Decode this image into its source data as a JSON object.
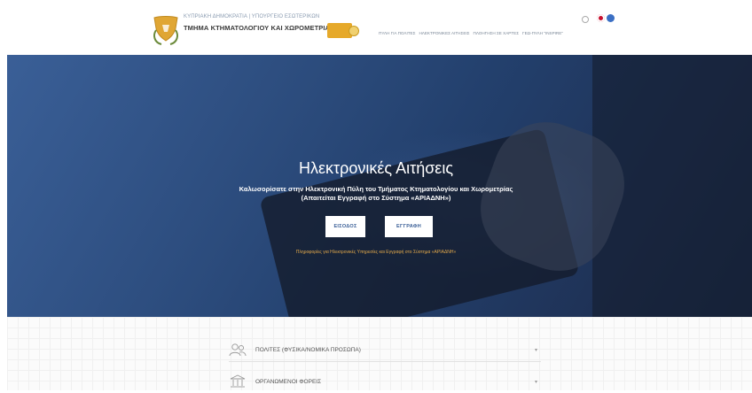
{
  "header": {
    "logo_subtitle": "ΚΥΠΡΙΑΚΗ ΔΗΜΟΚΡΑΤΙΑ | ΥΠΟΥΡΓΕΙΟ ΕΣΩΤΕΡΙΚΩΝ",
    "logo_title": "ΤΜΗΜΑ ΚΤΗΜΑΤΟΛΟΓΙΟΥ ΚΑΙ ΧΩΡΟΜΕΤΡΙΑΣ",
    "nav": [
      "ΠΥΛΗ ΓΙΑ ΠΟΛΙΤΕΣ",
      "ΗΛΕΚΤΡΟΝΙΚΕΣ ΑΙΤΗΣΕΙΣ",
      "ΠΛΟΗΓΗΣΗ ΣΕ ΧΑΡΤΕΣ",
      "ΓΕΩ-ΠΥΛΗ \"INSPIRE\""
    ]
  },
  "hero": {
    "title": "Ηλεκτρονικές Αιτήσεις",
    "subtitle_line1": "Καλωσορίσατε στην Ηλεκτρονική Πύλη του Τμήματος Κτηματολογίου και Χωρομετρίας",
    "subtitle_line2": "(Απαιτείται Εγγραφή στο Σύστημα «ΑΡΙΑΔΝΗ»)",
    "login_label": "ΕΙΣΟΔΟΣ",
    "register_label": "ΕΓΓΡΑΦΗ",
    "info_link": "Πληροφορίες για Ηλεκτρονικές Υπηρεσίες και Εγγραφή στο Σύστημα «ΑΡΙΑΔΝΗ»"
  },
  "categories": [
    {
      "label": "ΠΟΛΙΤΕΣ (ΦΥΣΙΚΑ/ΝΟΜΙΚΑ ΠΡΟΣΩΠΑ)",
      "icon": "people-icon"
    },
    {
      "label": "ΟΡΓΑΝΩΜΕΝΟΙ ΦΟΡΕΙΣ",
      "icon": "institution-icon"
    }
  ],
  "colors": {
    "hero_blue": "#2c4c7d",
    "button_text": "#3a5f97",
    "info_link": "#e3a94a",
    "badge": "#e6a92a"
  }
}
